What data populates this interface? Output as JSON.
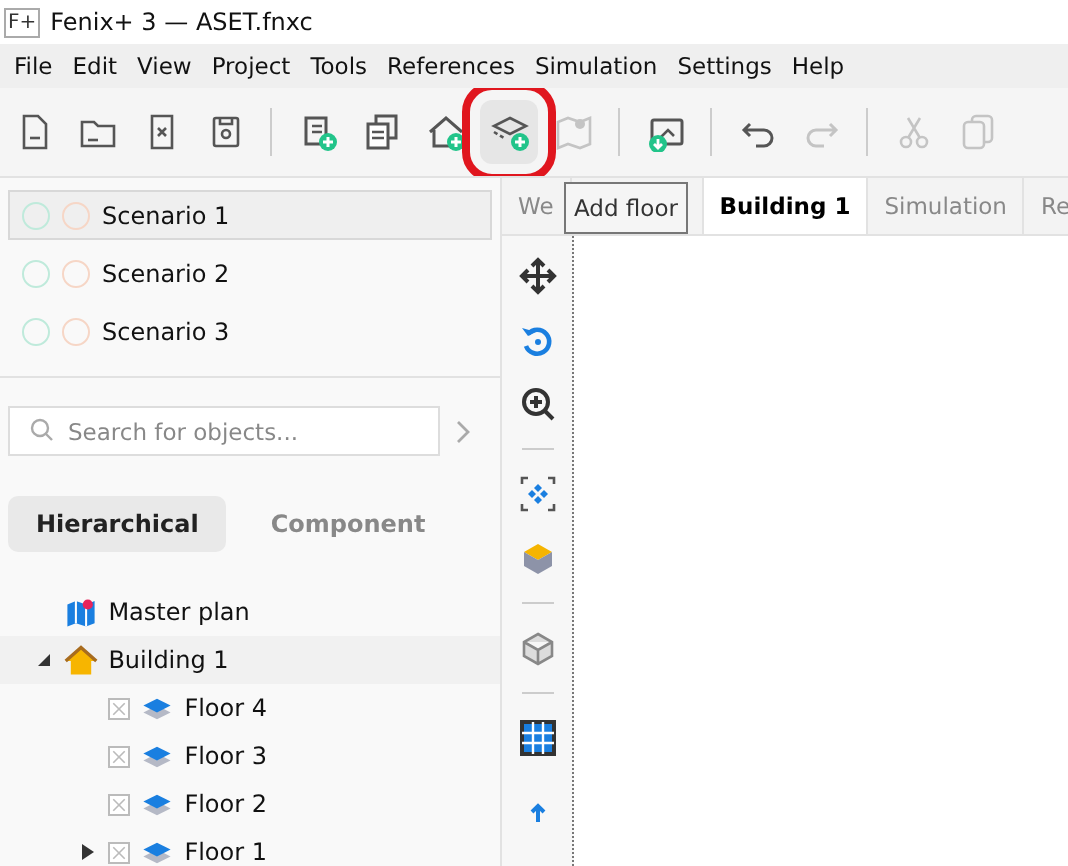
{
  "window": {
    "title": "Fenix+ 3 — ASET.fnxc",
    "logo": "F+"
  },
  "menu": [
    "File",
    "Edit",
    "View",
    "Project",
    "Tools",
    "References",
    "Simulation",
    "Settings",
    "Help"
  ],
  "toolbar": [
    {
      "kind": "new",
      "disabled": false,
      "highlighted": false
    },
    {
      "kind": "open",
      "disabled": false,
      "highlighted": false
    },
    {
      "kind": "close",
      "disabled": false,
      "highlighted": false
    },
    {
      "kind": "save",
      "disabled": false,
      "highlighted": false
    },
    {
      "kind": "separator"
    },
    {
      "kind": "add-report",
      "disabled": false,
      "highlighted": false
    },
    {
      "kind": "copies",
      "disabled": false,
      "highlighted": false
    },
    {
      "kind": "add-building",
      "disabled": false,
      "highlighted": false
    },
    {
      "kind": "add-floor",
      "disabled": false,
      "highlighted": true
    },
    {
      "kind": "map",
      "disabled": true,
      "highlighted": false
    },
    {
      "kind": "separator"
    },
    {
      "kind": "import-image",
      "disabled": false,
      "highlighted": false
    },
    {
      "kind": "separator"
    },
    {
      "kind": "undo",
      "disabled": false,
      "highlighted": false
    },
    {
      "kind": "redo",
      "disabled": true,
      "highlighted": false
    },
    {
      "kind": "separator"
    },
    {
      "kind": "cut",
      "disabled": true,
      "highlighted": false
    },
    {
      "kind": "copy",
      "disabled": true,
      "highlighted": false
    }
  ],
  "tooltip": {
    "text": "Add floor"
  },
  "scenarios": [
    {
      "name": "Scenario 1",
      "selected": true
    },
    {
      "name": "Scenario 2",
      "selected": false
    },
    {
      "name": "Scenario 3",
      "selected": false
    }
  ],
  "search": {
    "placeholder": "Search for objects..."
  },
  "view_tabs": [
    {
      "label": "Hierarchical",
      "selected": true
    },
    {
      "label": "Component",
      "selected": false
    }
  ],
  "tree": [
    {
      "label": "Master plan",
      "kind": "plan"
    },
    {
      "label": "Building 1",
      "kind": "building",
      "expanded": true,
      "children": [
        {
          "label": "Floor 4",
          "kind": "floor"
        },
        {
          "label": "Floor 3",
          "kind": "floor"
        },
        {
          "label": "Floor 2",
          "kind": "floor"
        },
        {
          "label": "Floor 1",
          "kind": "floor",
          "expanded": false
        }
      ]
    }
  ],
  "doc_tabs": [
    {
      "label": "We",
      "selected": false
    },
    {
      "label": "Building 1",
      "selected": true
    },
    {
      "label": "Simulation",
      "selected": false
    },
    {
      "label": "Re",
      "selected": false
    }
  ],
  "side_tools": [
    {
      "kind": "move"
    },
    {
      "kind": "rotate"
    },
    {
      "kind": "zoom"
    },
    {
      "kind": "separator"
    },
    {
      "kind": "fit"
    },
    {
      "kind": "solid"
    },
    {
      "kind": "separator"
    },
    {
      "kind": "wire"
    },
    {
      "kind": "separator"
    },
    {
      "kind": "grid"
    },
    {
      "kind": "up"
    }
  ]
}
